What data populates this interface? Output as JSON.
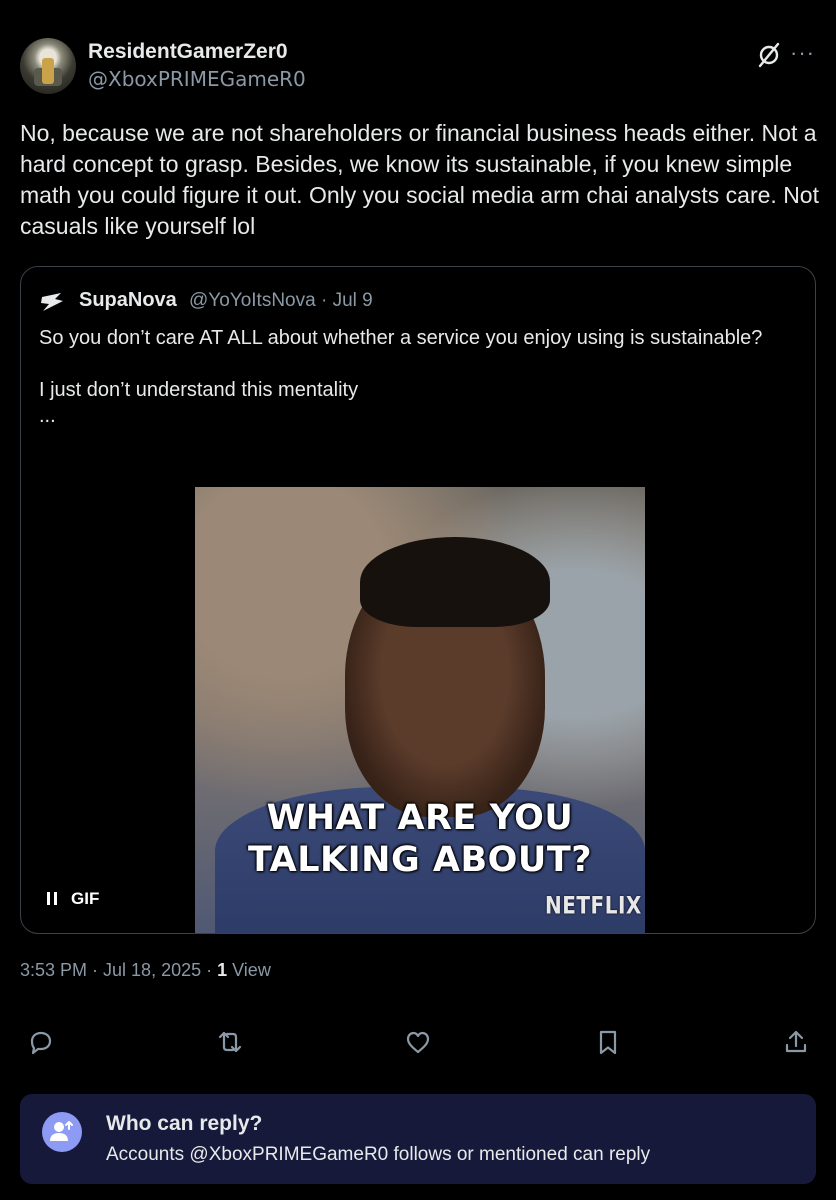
{
  "post": {
    "display_name": "ResidentGamerZer0",
    "handle": "@XboxPRIMEGameR0",
    "text": "No, because we are not shareholders or financial business heads either. Not a hard concept to grasp. Besides, we know its sustainable, if you knew simple math you could figure it out. Only you social media arm chai analysts care. Not casuals like yourself lol",
    "more_label": "···"
  },
  "quote": {
    "display_name": "SupaNova",
    "handle_date": "@YoYoItsNova · Jul 9",
    "text": "So you don’t care AT ALL about whether a service you enjoy using is sustainable?\n\nI just don’t understand this mentality\n...",
    "gif": {
      "caption_line1": "WHAT ARE YOU",
      "caption_line2": "TALKING ABOUT?",
      "brand": "NETFLIX",
      "badge": "GIF"
    }
  },
  "meta": {
    "timestamp": "3:53 PM · Jul 18, 2025 · ",
    "views_count": "1",
    "views_label": " View"
  },
  "actions": {
    "icons": [
      "reply-icon",
      "repost-icon",
      "like-icon",
      "bookmark-icon",
      "share-icon"
    ]
  },
  "reply_restriction": {
    "title": "Who can reply?",
    "description": "Accounts @XboxPRIMEGameR0 follows or mentioned can reply"
  },
  "colors": {
    "background": "#000000",
    "text_primary": "#e7e9ea",
    "text_secondary": "#8b98a5",
    "reply_box_bg": "#16193a",
    "reply_icon_bg": "#8d9bf5"
  }
}
